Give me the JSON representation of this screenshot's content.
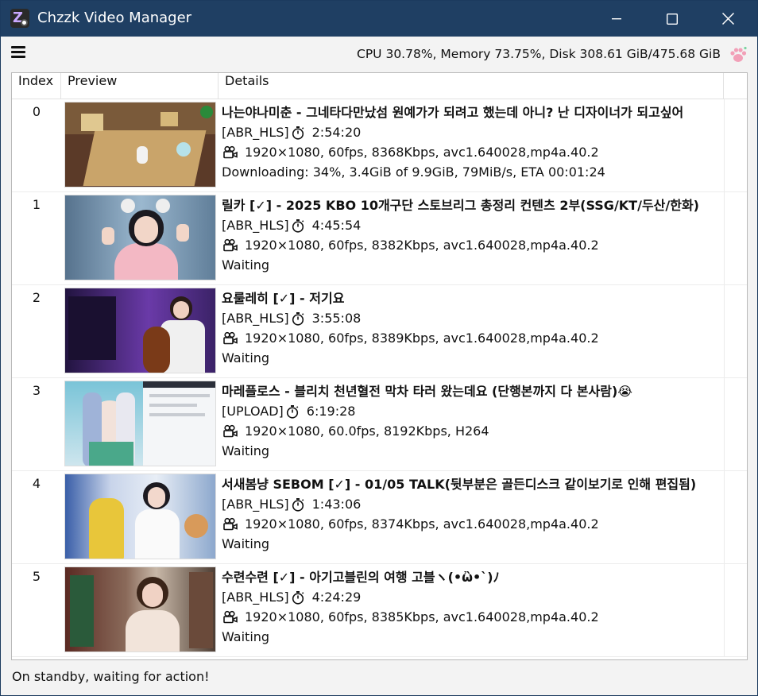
{
  "window": {
    "title": "Chzzk Video Manager",
    "app_icon": "chzzk-logo",
    "controls": [
      "minimize-icon",
      "maximize-icon",
      "close-icon"
    ]
  },
  "toolbar": {
    "menu_icon": "hamburger-menu-icon",
    "sysinfo": "CPU 30.78%, Memory 73.75%, Disk 308.61 GiB/475.68 GiB",
    "mascot_icon": "paw-icon"
  },
  "table": {
    "headers": {
      "index": "Index",
      "preview": "Preview",
      "details": "Details"
    },
    "rows": [
      {
        "index": "0",
        "title": "나는야나미춘 - 그네타다만났섬 원예가가 되려고 했는데 아니? 난 디자이너가 되고싶어",
        "source": "[ABR_HLS]",
        "duration": "2:54:20",
        "specs": "1920×1080, 60fps, 8368Kbps, avc1.640028,mp4a.40.2",
        "status": "Downloading: 34%, 3.4GiB of 9.9GiB, 79MiB/s, ETA 00:01:24"
      },
      {
        "index": "1",
        "title": "릴카 [✓] - 2025 KBO 10개구단 스토브리그 총정리 컨텐츠 2부(SSG/KT/두산/한화)",
        "source": "[ABR_HLS]",
        "duration": "4:45:54",
        "specs": "1920×1080, 60fps, 8382Kbps, avc1.640028,mp4a.40.2",
        "status": "Waiting"
      },
      {
        "index": "2",
        "title": "요룰레히 [✓] - 저기요",
        "source": "[ABR_HLS]",
        "duration": "3:55:08",
        "specs": "1920×1080, 60fps, 8389Kbps, avc1.640028,mp4a.40.2",
        "status": "Waiting"
      },
      {
        "index": "3",
        "title": "마레플로스 - 블리치 천년혈전 막차 타러 왔는데요 (단행본까지 다 본사람)😭",
        "source": "[UPLOAD]",
        "duration": "6:19:28",
        "specs": "1920×1080, 60.0fps, 8192Kbps, H264",
        "status": "Waiting"
      },
      {
        "index": "4",
        "title": "서새봄냥 SEBOM [✓] - 01/05 TALK(뒷부분은 골든디스크 같이보기로 인해 편집됨)",
        "source": "[ABR_HLS]",
        "duration": "1:43:06",
        "specs": "1920×1080, 60fps, 8374Kbps, avc1.640028,mp4a.40.2",
        "status": "Waiting"
      },
      {
        "index": "5",
        "title": "수련수련 [✓] - 아기고블린의 여행 고블ヽ(•ὢ•`)ﾉ",
        "source": "[ABR_HLS]",
        "duration": "4:24:29",
        "specs": "1920×1080, 60fps, 8385Kbps, avc1.640028,mp4a.40.2",
        "status": "Waiting"
      }
    ],
    "row_icons": {
      "duration": "stopwatch-icon",
      "specs": "video-camera-icon"
    }
  },
  "statusbar": {
    "text": "On standby, waiting for action!"
  }
}
